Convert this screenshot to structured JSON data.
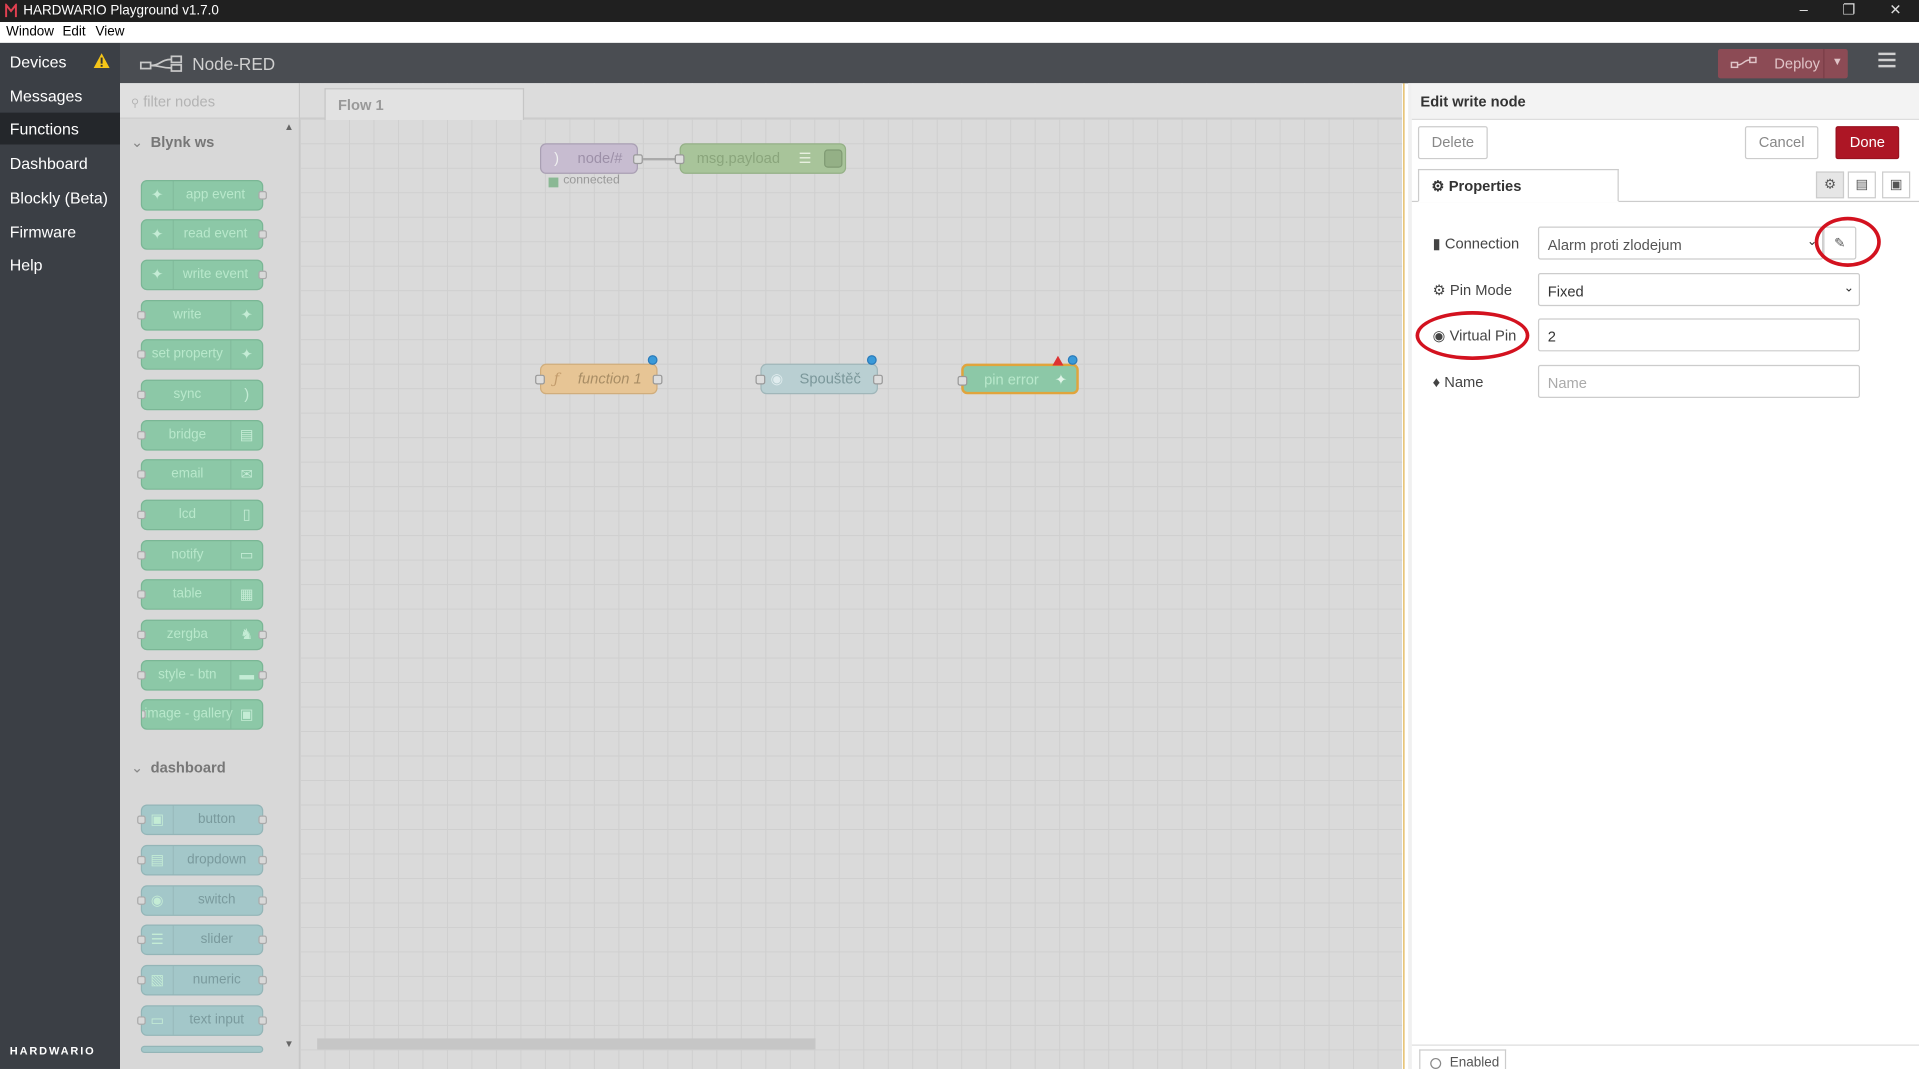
{
  "window": {
    "title": "HARDWARIO Playground v1.7.0",
    "menus": [
      "Window",
      "Edit",
      "View"
    ]
  },
  "app_nav": {
    "items": [
      {
        "label": "Devices",
        "warning": true
      },
      {
        "label": "Messages"
      },
      {
        "label": "Functions",
        "active": true
      },
      {
        "label": "Dashboard"
      },
      {
        "label": "Blockly (Beta)"
      },
      {
        "label": "Firmware"
      },
      {
        "label": "Help"
      }
    ],
    "brand": "HARDWARIO"
  },
  "nodered": {
    "brand": "Node-RED",
    "deploy_label": "Deploy"
  },
  "palette": {
    "filter_placeholder": "filter nodes",
    "categories": [
      {
        "label": "Blynk ws",
        "nodes": [
          "app event",
          "read event",
          "write event",
          "write",
          "set property",
          "sync",
          "bridge",
          "email",
          "lcd",
          "notify",
          "table",
          "zergba",
          "style - btn",
          "image - gallery"
        ]
      },
      {
        "label": "dashboard",
        "nodes": [
          "button",
          "dropdown",
          "switch",
          "slider",
          "numeric",
          "text input"
        ]
      }
    ]
  },
  "workspace": {
    "tab": "Flow 1",
    "nodes": [
      {
        "label": "node/#",
        "status": "connected"
      },
      {
        "label": "msg.payload"
      },
      {
        "label": "function 1"
      },
      {
        "label": "Spouštěč"
      },
      {
        "label": "pin error"
      }
    ]
  },
  "editor": {
    "title": "Edit write node",
    "delete_label": "Delete",
    "cancel_label": "Cancel",
    "done_label": "Done",
    "tab_label": "Properties",
    "fields": {
      "connection": {
        "label": "Connection",
        "value": "Alarm proti zlodejum"
      },
      "pin_mode": {
        "label": "Pin Mode",
        "value": "Fixed"
      },
      "virtual_pin": {
        "label": "Virtual Pin",
        "value": "2"
      },
      "name": {
        "label": "Name",
        "placeholder": "Name"
      }
    },
    "enabled_label": "Enabled"
  },
  "colors": {
    "accent_done": "#ad1625",
    "annotation_ring": "#d3121f",
    "deploy": "#8c4b55"
  }
}
